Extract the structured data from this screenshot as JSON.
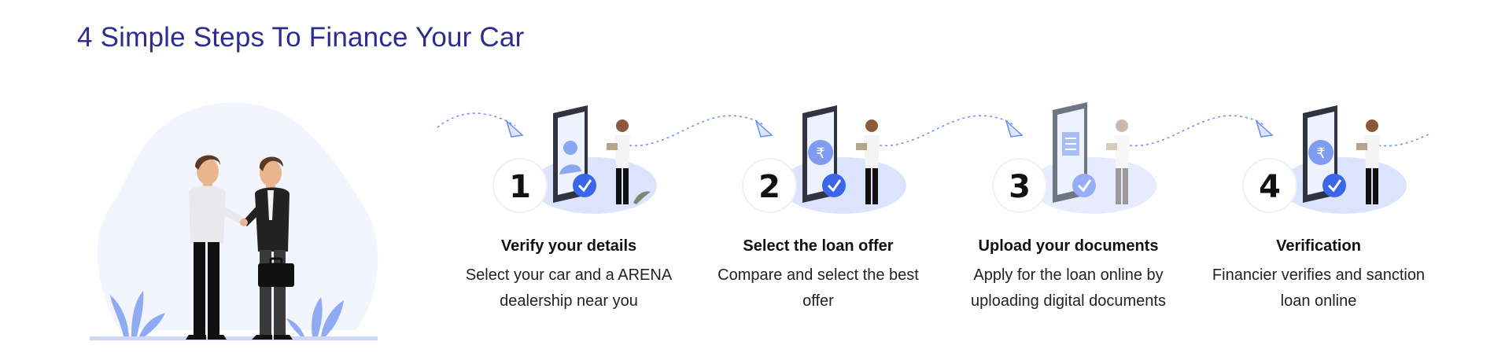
{
  "page": {
    "title": "4 Simple Steps To Finance Your Car",
    "accent_color": "#2e2d8f",
    "illustration_color": "#6b8cf5"
  },
  "hero": {
    "icon": "handshake-illustration"
  },
  "steps": [
    {
      "number": "1",
      "title": "Verify your details",
      "description": "Select your car and a ARENA dealership near you",
      "icon": "user-verify-icon"
    },
    {
      "number": "2",
      "title": "Select the loan offer",
      "description": "Compare and select the best offer",
      "icon": "rupee-offer-icon"
    },
    {
      "number": "3",
      "title": "Upload your documents",
      "description": "Apply for the loan online by uploading digital documents",
      "icon": "document-upload-icon"
    },
    {
      "number": "4",
      "title": "Verification",
      "description": "Financier verifies and sanction loan online",
      "icon": "rupee-verify-icon"
    }
  ]
}
